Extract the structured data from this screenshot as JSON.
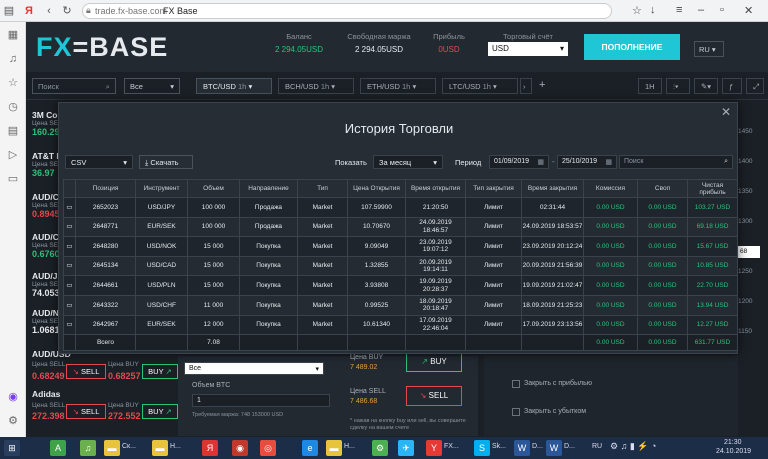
{
  "browser": {
    "url": "trade.fx-base.com",
    "title": "FX Base"
  },
  "header": {
    "logo_left": "FX",
    "logo_mid": "=",
    "logo_right": "BASE",
    "balance_label": "Баланс",
    "balance_value": "2 294.05USD",
    "margin_label": "Свободная маржа",
    "margin_value": "2 294.05USD",
    "profit_label": "Прибыль",
    "profit_value": "0USD",
    "account_label": "Торговый счёт",
    "account_value": "USD",
    "deposit_label": "ПОПОЛНЕНИЕ",
    "lang": "RU"
  },
  "toolbar": {
    "search_placeholder": "Поиск",
    "filter": "Все",
    "tabs": [
      {
        "label": "BTC/USD",
        "tf": "1h"
      },
      {
        "label": "BCH/USD",
        "tf": "1h"
      },
      {
        "label": "ETH/USD",
        "tf": "1h"
      },
      {
        "label": "LTC/USD",
        "tf": "1h"
      }
    ],
    "tf_right": "1H"
  },
  "instruments": [
    {
      "name": "3M Co",
      "sell_label": "Цена SELL",
      "sell": "160.29"
    },
    {
      "name": "AT&T I",
      "sell_label": "Цена SELL",
      "sell": "36.97"
    },
    {
      "name": "AUD/C",
      "sell_label": "Цена SELL",
      "sell": "0.8945"
    },
    {
      "name": "AUD/C",
      "sell_label": "Цена SELL",
      "sell": "0.6760"
    },
    {
      "name": "AUD/J",
      "sell_label": "Цена SELL",
      "sell": "74.053"
    },
    {
      "name": "AUD/N",
      "sell_label": "Цена SELL",
      "sell": "1.0681"
    },
    {
      "name": "AUD/USD",
      "sell_label": "Цена SELL",
      "buy_label": "Цена BUY",
      "sell": "0.68249",
      "buy": "0.68257",
      "sell_btn": "SELL",
      "buy_btn": "BUY"
    },
    {
      "name": "Adidas",
      "sell_label": "Цена SELL",
      "buy_label": "Цена BUY",
      "sell": "272.398",
      "buy": "272.552",
      "sell_btn": "SELL",
      "buy_btn": "BUY"
    }
  ],
  "chart_axis": [
    "1450",
    "1400",
    "1350",
    "1300",
    "1250",
    "1200",
    "1150",
    "68"
  ],
  "order_panel": {
    "type": "Все",
    "volume_label": "Объем BTC",
    "volume": "1",
    "margin_note": "Требуемая маржа: 748 153000 USD",
    "buy_price_label": "Цена BUY",
    "buy_price": "7 489.02",
    "buy_btn": "BUY",
    "sell_price_label": "Цена SELL",
    "sell_price": "7 486.68",
    "sell_btn": "SELL",
    "note": "* нажав на кнопку buy или sell, вы совершите сделку на вашем счете",
    "close_profit": "Закрыть с прибылью",
    "close_loss": "Закрыть с убытком"
  },
  "modal": {
    "title": "История Торговли",
    "format": "CSV",
    "download": "Скачать",
    "show_label": "Показать",
    "period_option": "За месяц",
    "period_label": "Период",
    "date_from": "01/09/2019",
    "date_to": "25/10/2019",
    "search_placeholder": "Поиск",
    "columns": [
      "Позиция",
      "Инструмент",
      "Объем",
      "Направление",
      "Тип",
      "Цена Открытия",
      "Время открытия",
      "Тип закрытия",
      "Время закрытия",
      "Комиссия",
      "Своп",
      "Чистая прибыль"
    ],
    "rows": [
      {
        "pos": "2652023",
        "inst": "USD/JPY",
        "vol": "100 000",
        "dir": "Продажа",
        "type": "Market",
        "open": "107.59900",
        "open_time": "21:20:50",
        "close_type": "Лимит",
        "close_time": "02:31:44",
        "fee": "0.00 USD",
        "swap": "0.00 USD",
        "profit": "103.27 USD"
      },
      {
        "pos": "2648771",
        "inst": "EUR/SEK",
        "vol": "100 000",
        "dir": "Продажа",
        "type": "Market",
        "open": "10.70670",
        "open_time": "24.09.2019 18:46:57",
        "close_type": "Лимит",
        "close_time": "24.09.2019 18:53:57",
        "fee": "0.00 USD",
        "swap": "0.00 USD",
        "profit": "69.18 USD"
      },
      {
        "pos": "2648280",
        "inst": "USD/NOK",
        "vol": "15 000",
        "dir": "Покупка",
        "type": "Market",
        "open": "9.09049",
        "open_time": "23.09.2019 19:07:12",
        "close_type": "Лимит",
        "close_time": "23.09.2019 20:12:24",
        "fee": "0.00 USD",
        "swap": "0.00 USD",
        "profit": "15.67 USD"
      },
      {
        "pos": "2645134",
        "inst": "USD/CAD",
        "vol": "15 000",
        "dir": "Покупка",
        "type": "Market",
        "open": "1.32855",
        "open_time": "20.09.2019 19:14:11",
        "close_type": "Лимит",
        "close_time": "20.09.2019 21:56:39",
        "fee": "0.00 USD",
        "swap": "0.00 USD",
        "profit": "10.85 USD"
      },
      {
        "pos": "2644661",
        "inst": "USD/PLN",
        "vol": "15 000",
        "dir": "Покупка",
        "type": "Market",
        "open": "3.93808",
        "open_time": "19.09.2019 20:28:37",
        "close_type": "Лимит",
        "close_time": "19.09.2019 21:02:47",
        "fee": "0.00 USD",
        "swap": "0.00 USD",
        "profit": "22.70 USD"
      },
      {
        "pos": "2643322",
        "inst": "USD/CHF",
        "vol": "11 000",
        "dir": "Покупка",
        "type": "Market",
        "open": "0.99525",
        "open_time": "18.09.2019 20:18:47",
        "close_type": "Лимит",
        "close_time": "18.09.2019 21:25:23",
        "fee": "0.00 USD",
        "swap": "0.00 USD",
        "profit": "13.94 USD"
      },
      {
        "pos": "2642967",
        "inst": "EUR/SEK",
        "vol": "12 000",
        "dir": "Покупка",
        "type": "Market",
        "open": "10.61340",
        "open_time": "17.09.2019 22:46:04",
        "close_type": "Лимит",
        "close_time": "17.09.2019 23:13:56",
        "fee": "0.00 USD",
        "swap": "0.00 USD",
        "profit": "12.27 USD"
      }
    ],
    "total": {
      "label": "Всего",
      "volume": "7.08",
      "fee": "0.00 USD",
      "swap": "0.00 USD",
      "profit": "631.77 USD"
    }
  },
  "taskbar": {
    "items": [
      "Ск...",
      "Н...",
      "Н...",
      "FX...",
      "Sk...",
      "D...",
      "D..."
    ],
    "lang": "RU",
    "time": "21:30",
    "date": "24.10.2019"
  },
  "colors": {
    "accent": "#1ec6d6",
    "sell": "#e5484d",
    "buy": "#2bc37a",
    "bg": "#1b2026"
  }
}
